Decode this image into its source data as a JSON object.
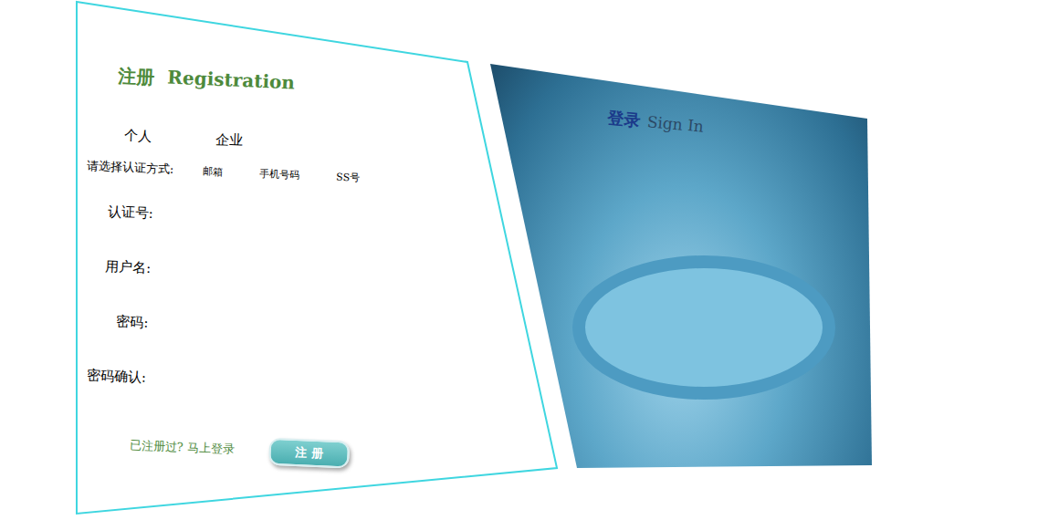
{
  "registration": {
    "title": "注册",
    "subtitle": "Registration",
    "account_types": [
      {
        "label": "个人",
        "selected": false
      },
      {
        "label": "企业",
        "selected": false
      }
    ],
    "auth_prompt": "请选择认证方式:",
    "auth_methods": [
      {
        "label": "邮箱",
        "selected": false
      },
      {
        "label": "手机号码",
        "selected": false
      },
      {
        "label": "SS号",
        "selected": false
      }
    ],
    "fields": [
      {
        "label": "认证号:",
        "value": ""
      },
      {
        "label": "用户名:",
        "value": ""
      },
      {
        "label": "密码:",
        "value": ""
      },
      {
        "label": "密码确认:",
        "value": ""
      }
    ],
    "login_link": "已注册过? 马上登录",
    "submit": "注 册"
  },
  "sign_in": {
    "title": "登录",
    "subtitle": "Sign In"
  }
}
